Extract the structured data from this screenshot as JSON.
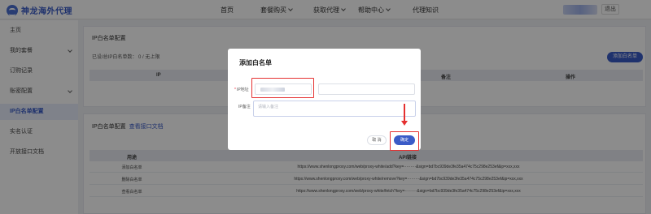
{
  "brand": {
    "name": "神龙海外代理"
  },
  "nav": {
    "items": [
      {
        "label": "首页",
        "has_dropdown": false
      },
      {
        "label": "套餐购买",
        "has_dropdown": true
      },
      {
        "label": "获取代理",
        "has_dropdown": true
      },
      {
        "label": "帮助中心",
        "has_dropdown": true
      },
      {
        "label": "代理知识",
        "has_dropdown": false
      }
    ],
    "logout_label": "退出"
  },
  "sidebar": {
    "items": [
      {
        "label": "主页",
        "has_dropdown": false,
        "active": false
      },
      {
        "label": "我的套餐",
        "has_dropdown": true,
        "active": false
      },
      {
        "label": "订购记录",
        "has_dropdown": false,
        "active": false
      },
      {
        "label": "账密配置",
        "has_dropdown": true,
        "active": false
      },
      {
        "label": "IP白名单配置",
        "has_dropdown": false,
        "active": true
      },
      {
        "label": "实名认证",
        "has_dropdown": false,
        "active": false
      },
      {
        "label": "开放接口文档",
        "has_dropdown": false,
        "active": false
      }
    ]
  },
  "whitelist_card": {
    "title": "IP白名单配置",
    "count_text": "已设/总IP白名单数： 0 / 无上限",
    "add_button": "添加白名单",
    "columns": [
      "IP",
      "备注",
      "操作"
    ]
  },
  "api_card": {
    "title": "IP白名单配置",
    "doc_link": "查看接口文档",
    "columns": [
      "用途",
      "API链接"
    ],
    "rows": [
      {
        "purpose": "添加白名单",
        "url": "https://www.shenlongproxy.com/web/proxy-white/add?key=·········&sign=bd7bc939de3fe35a474c75c298e253ef&ip=xxx,xxx"
      },
      {
        "purpose": "删除白名单",
        "url": "https://www.shenlongproxy.com/web/proxy-white/remove?key=·········&sign=bd7bc939de3fe35a474c75c298e253ef&ip=xxx,xxx"
      },
      {
        "purpose": "查看白名单",
        "url": "https://www.shenlongproxy.com/web/proxy-white/fetch?key=·········&sign=bd7bc939de3fe35a474c75c298e253ef&ip=xxx,xxx"
      }
    ]
  },
  "modal": {
    "title": "添加白名单",
    "ip_label": "IP地址",
    "ip_value": "·········",
    "note_label": "IP备注",
    "note_placeholder": "请输入备注",
    "cancel_label": "取 消",
    "confirm_label": "确定"
  },
  "colors": {
    "accent": "#3a5bc7",
    "highlight": "#e53030",
    "active_bg": "#e8edfb"
  }
}
